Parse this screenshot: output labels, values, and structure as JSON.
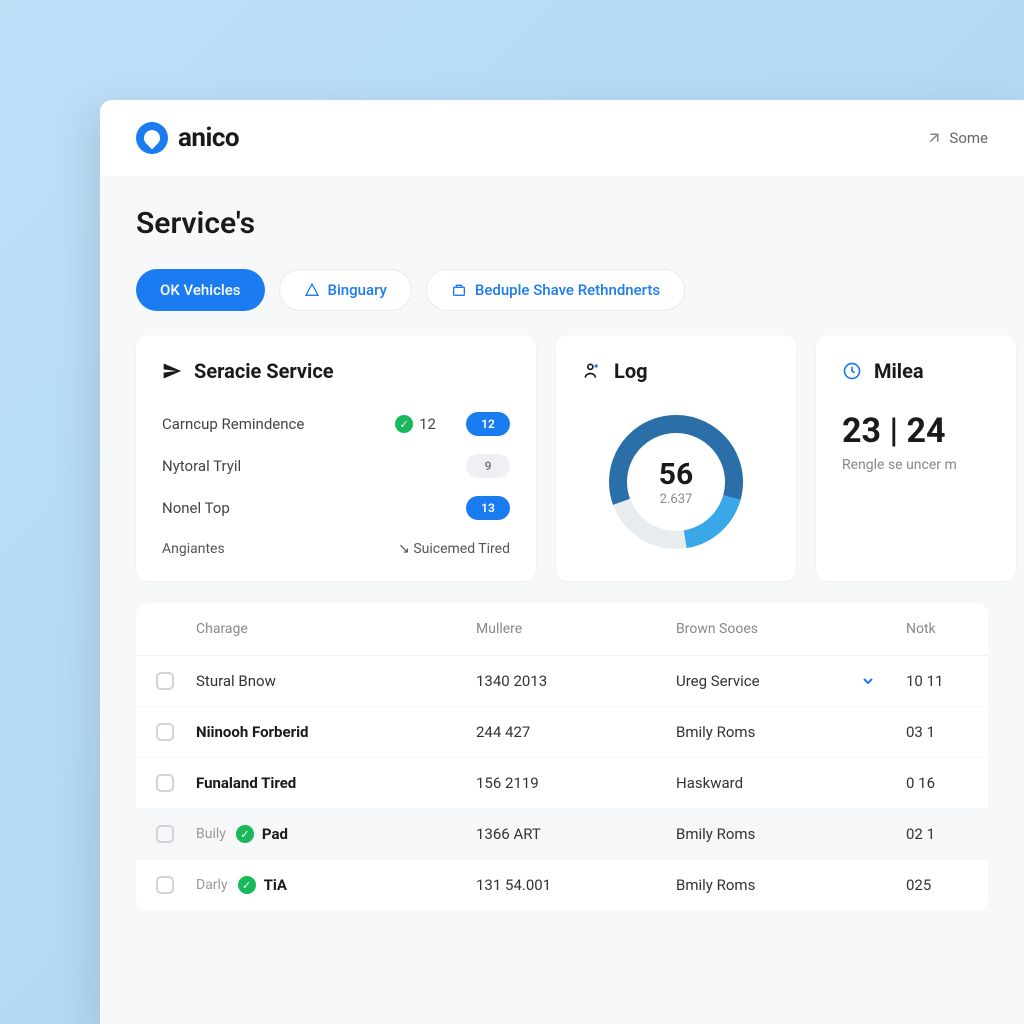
{
  "header": {
    "brand": "anico",
    "right_label": "Some"
  },
  "page_title": "Service's",
  "tabs": [
    {
      "label": "OK Vehicles",
      "active": true
    },
    {
      "label": "Binguary",
      "active": false
    },
    {
      "label": "Beduple Shave Rethndnerts",
      "active": false
    }
  ],
  "service_card": {
    "title": "Seracie Service",
    "rows": [
      {
        "label": "Carncup Remindence",
        "check": true,
        "mid_value": "12",
        "pill": "12",
        "pill_style": "blue"
      },
      {
        "label": "Nytoral Tryil",
        "check": false,
        "mid_value": "",
        "pill": "9",
        "pill_style": "gray"
      },
      {
        "label": "Nonel Top",
        "check": false,
        "mid_value": "",
        "pill": "13",
        "pill_style": "blue"
      }
    ],
    "footer_left": "Angiantes",
    "footer_right": "Suicemed Tired"
  },
  "log_card": {
    "title": "Log",
    "center_value": "56",
    "center_sub": "2.637"
  },
  "milea_card": {
    "title": "Milea",
    "big": "23 | 24",
    "sub": "Rengle se uncer m"
  },
  "table": {
    "headers": [
      "Charage",
      "Mullere",
      "Brown Sooes",
      "Notk"
    ],
    "rows": [
      {
        "prefix": "",
        "name": "Stural Bnow",
        "bold": false,
        "check": false,
        "mullere": "1340 2013",
        "brown": "Ureg Service",
        "chevron": true,
        "notk": "10 11",
        "highlight": false
      },
      {
        "prefix": "",
        "name": "Niinooh Forberid",
        "bold": true,
        "check": false,
        "mullere": "244 427",
        "brown": "Bmily Roms",
        "chevron": false,
        "notk": "03 1",
        "highlight": false
      },
      {
        "prefix": "",
        "name": "Funaland Tired",
        "bold": true,
        "check": false,
        "mullere": "156 2119",
        "brown": "Haskward",
        "chevron": false,
        "notk": "0 16",
        "highlight": false
      },
      {
        "prefix": "Buily",
        "name": "Pad",
        "bold": true,
        "check": true,
        "mullere": "1366 ART",
        "brown": "Bmily Roms",
        "chevron": false,
        "notk": "02 1",
        "highlight": true
      },
      {
        "prefix": "Darly",
        "name": "TiA",
        "bold": true,
        "check": true,
        "mullere": "131 54.001",
        "brown": "Bmily Roms",
        "chevron": false,
        "notk": "025",
        "highlight": false
      }
    ]
  },
  "chart_data": {
    "type": "pie",
    "title": "Log",
    "series": [
      {
        "name": "segment-dark",
        "value": 60,
        "color": "#2b6fa8"
      },
      {
        "name": "segment-light",
        "value": 18,
        "color": "#3aa7e8"
      },
      {
        "name": "segment-empty",
        "value": 22,
        "color": "#e8ecef"
      }
    ],
    "center_value": 56,
    "center_sub": "2.637"
  }
}
